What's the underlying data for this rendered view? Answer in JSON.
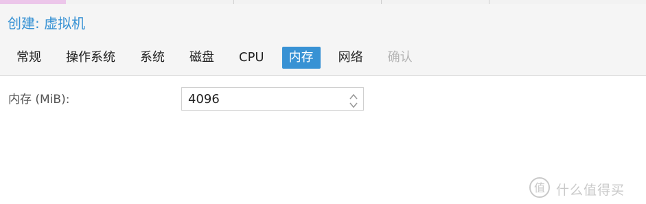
{
  "dialog": {
    "title": "创建: 虚拟机"
  },
  "tabs": [
    {
      "label": "常规",
      "state": "normal"
    },
    {
      "label": "操作系统",
      "state": "normal"
    },
    {
      "label": "系统",
      "state": "normal"
    },
    {
      "label": "磁盘",
      "state": "normal"
    },
    {
      "label": "CPU",
      "state": "normal"
    },
    {
      "label": "内存",
      "state": "active"
    },
    {
      "label": "网络",
      "state": "normal"
    },
    {
      "label": "确认",
      "state": "disabled"
    }
  ],
  "memory_form": {
    "label": "内存 (MiB):",
    "value": "4096"
  },
  "colors": {
    "accent": "#3892d4",
    "header_bg": "#f5f5f5",
    "disabled_text": "#b5b5b5"
  },
  "watermark": {
    "text": "什么值得买",
    "icon": "zhide-logo-icon"
  }
}
